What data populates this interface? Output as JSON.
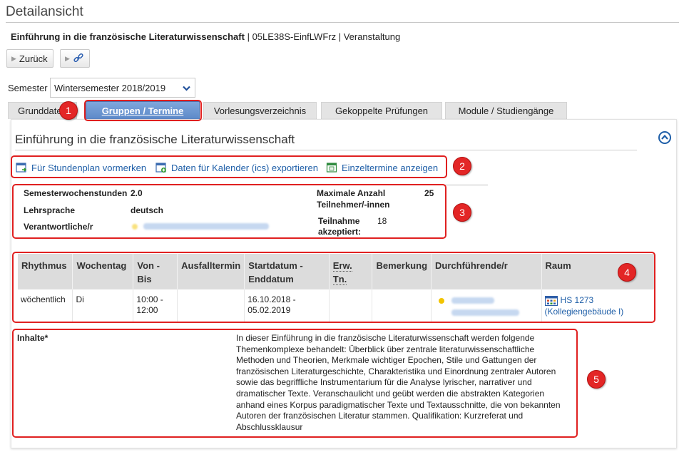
{
  "page": {
    "title": "Detailansicht",
    "course_title": "Einführung in die französische Literaturwissenschaft",
    "course_meta": "| 05LE38S-EinfLWFrz | Veranstaltung"
  },
  "toolbar": {
    "back_label": "Zurück"
  },
  "semester": {
    "label": "Semester",
    "selected": "Wintersemester 2018/2019"
  },
  "tabs": [
    {
      "label": "Grunddaten"
    },
    {
      "label": "Gruppen / Termine"
    },
    {
      "label": "Vorlesungsverzeichnis"
    },
    {
      "label": "Gekoppelte Prüfungen"
    },
    {
      "label": "Module / Studiengänge"
    }
  ],
  "section": {
    "title": "Einführung in die französische Literaturwissenschaft"
  },
  "actions": [
    {
      "label": "Für Stundenplan vormerken"
    },
    {
      "label": "Daten für Kalender (ics) exportieren"
    },
    {
      "label": "Einzeltermine anzeigen"
    }
  ],
  "info": {
    "sws_label": "Semesterwochenstunden",
    "sws_value": "2.0",
    "lang_label": "Lehrsprache",
    "lang_value": "deutsch",
    "resp_label": "Verantwortliche/r",
    "max_label_1": "Maximale Anzahl",
    "max_label_2": "Teilnehmer/-innen",
    "max_value": "25",
    "acc_label_1": "Teilnahme",
    "acc_label_2": "akzeptiert:",
    "acc_value": "18"
  },
  "schedule": {
    "headers": [
      "Rhythmus",
      "Wochentag",
      "Von -",
      "Bis",
      "Ausfalltermin",
      "Startdatum -",
      "Enddatum",
      "Erw. Tn.",
      "Bemerkung",
      "Durchführende/r",
      "Raum"
    ],
    "row": {
      "rhythm": "wöchentlich",
      "weekday": "Di",
      "from": "10:00 -",
      "to": "12:00",
      "start": "16.10.2018 -",
      "end": "05.02.2019",
      "room": "HS 1273",
      "building": "(Kollegiengebäude I)"
    }
  },
  "content": {
    "label": "Inhalte*",
    "text": "In dieser Einführung in die französische Literaturwissenschaft werden folgende Themenkomplexe behandelt: Überblick über zentrale literaturwissenschaftliche Methoden und Theorien, Merkmale wichtiger Epochen, Stile und Gattungen der französischen Literaturgeschichte, Charakteristika und Einordnung zentraler Autoren sowie das begriffliche Instrumentarium für die Analyse lyrischer, narrativer und dramatischer Texte. Veranschaulicht und geübt werden die abstrakten Kategorien anhand eines Korpus paradigmatischer Texte und Textausschnitte, die von bekannten Autoren der französischen Literatur stammen. Qualifikation: Kurzreferat und Abschlussklausur"
  },
  "annotations": [
    "1",
    "2",
    "3",
    "4",
    "5"
  ],
  "colors": {
    "accent": "#5d89c8",
    "link": "#1f5fa8",
    "annotation": "#e32626"
  }
}
